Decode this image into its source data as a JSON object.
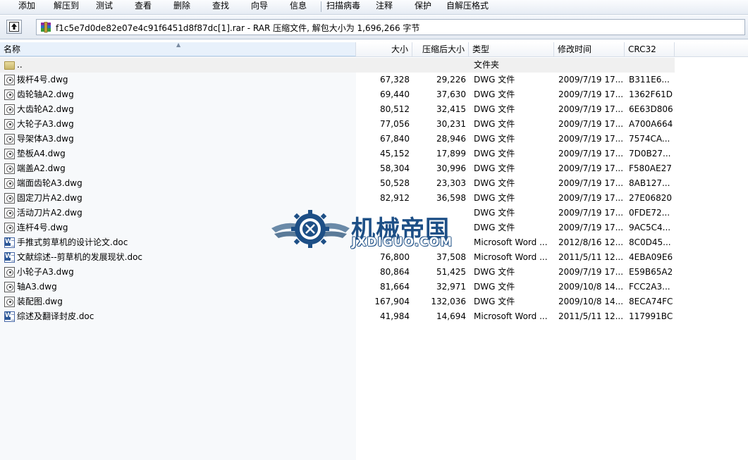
{
  "toolbar": {
    "items": [
      "添加",
      "解压到",
      "测试",
      "查看",
      "删除",
      "查找",
      "向导",
      "信息",
      "扫描病毒",
      "注释",
      "保护",
      "自解压格式"
    ]
  },
  "address": {
    "text": "f1c5e7d0de82e07e4c91f6451d8f87dc[1].rar - RAR 压缩文件, 解包大小为 1,696,266 字节",
    "archive_icon": "winrar-archive-icon",
    "up_icon": "up-folder-icon"
  },
  "columns": {
    "name": "名称",
    "size": "大小",
    "packed": "压缩后大小",
    "type": "类型",
    "modified": "修改时间",
    "crc": "CRC32"
  },
  "parent": {
    "name": "..",
    "type": "文件夹",
    "icon": "folder-icon"
  },
  "files": [
    {
      "name": "拨杆4号.dwg",
      "size": "67,328",
      "packed": "29,226",
      "type": "DWG 文件",
      "modified": "2009/7/19 17...",
      "crc": "B311E6...",
      "icon": "dwg-file-icon"
    },
    {
      "name": "齿轮轴A2.dwg",
      "size": "69,440",
      "packed": "37,630",
      "type": "DWG 文件",
      "modified": "2009/7/19 17...",
      "crc": "1362F61D",
      "icon": "dwg-file-icon"
    },
    {
      "name": "大齿轮A2.dwg",
      "size": "80,512",
      "packed": "32,415",
      "type": "DWG 文件",
      "modified": "2009/7/19 17...",
      "crc": "6E63D806",
      "icon": "dwg-file-icon"
    },
    {
      "name": "大轮子A3.dwg",
      "size": "77,056",
      "packed": "30,231",
      "type": "DWG 文件",
      "modified": "2009/7/19 17...",
      "crc": "A700A664",
      "icon": "dwg-file-icon"
    },
    {
      "name": "导架体A3.dwg",
      "size": "67,840",
      "packed": "28,946",
      "type": "DWG 文件",
      "modified": "2009/7/19 17...",
      "crc": "7574CA...",
      "icon": "dwg-file-icon"
    },
    {
      "name": "垫板A4.dwg",
      "size": "45,152",
      "packed": "17,899",
      "type": "DWG 文件",
      "modified": "2009/7/19 17...",
      "crc": "7D0B27...",
      "icon": "dwg-file-icon"
    },
    {
      "name": "端盖A2.dwg",
      "size": "58,304",
      "packed": "30,996",
      "type": "DWG 文件",
      "modified": "2009/7/19 17...",
      "crc": "F580AE27",
      "icon": "dwg-file-icon"
    },
    {
      "name": "端面齿轮A3.dwg",
      "size": "50,528",
      "packed": "23,303",
      "type": "DWG 文件",
      "modified": "2009/7/19 17...",
      "crc": "8AB127...",
      "icon": "dwg-file-icon"
    },
    {
      "name": "固定刀片A2.dwg",
      "size": "82,912",
      "packed": "36,598",
      "type": "DWG 文件",
      "modified": "2009/7/19 17...",
      "crc": "27E06820",
      "icon": "dwg-file-icon"
    },
    {
      "name": "活动刀片A2.dwg",
      "size": "",
      "packed": "",
      "type": "DWG 文件",
      "modified": "2009/7/19 17...",
      "crc": "0FDE72...",
      "icon": "dwg-file-icon"
    },
    {
      "name": "连杆4号.dwg",
      "size": "",
      "packed": "",
      "type": "DWG 文件",
      "modified": "2009/7/19 17...",
      "crc": "9AC5C4...",
      "icon": "dwg-file-icon"
    },
    {
      "name": "手推式剪草机的设计论文.doc",
      "size": "",
      "packed": "",
      "type": "Microsoft Word ...",
      "modified": "2012/8/16 12...",
      "crc": "8C0D45...",
      "icon": "word-doc-icon"
    },
    {
      "name": "文献综述--剪草机的发展现状.doc",
      "size": "76,800",
      "packed": "37,508",
      "type": "Microsoft Word ...",
      "modified": "2011/5/11 12...",
      "crc": "4EBA09E6",
      "icon": "word-doc-icon"
    },
    {
      "name": "小轮子A3.dwg",
      "size": "80,864",
      "packed": "51,425",
      "type": "DWG 文件",
      "modified": "2009/7/19 17...",
      "crc": "E59B65A2",
      "icon": "dwg-file-icon"
    },
    {
      "name": "轴A3.dwg",
      "size": "81,664",
      "packed": "32,971",
      "type": "DWG 文件",
      "modified": "2009/10/8 14...",
      "crc": "FCC2A3...",
      "icon": "dwg-file-icon"
    },
    {
      "name": "装配图.dwg",
      "size": "167,904",
      "packed": "132,036",
      "type": "DWG 文件",
      "modified": "2009/10/8 14...",
      "crc": "8ECA74FC",
      "icon": "dwg-file-icon"
    },
    {
      "name": "综述及翻译封皮.doc",
      "size": "41,984",
      "packed": "14,694",
      "type": "Microsoft Word ...",
      "modified": "2011/5/11 12...",
      "crc": "117991BC",
      "icon": "word-doc-icon"
    }
  ],
  "watermark": {
    "title": "机械帝国",
    "subtitle": "JXDIGUO.COM",
    "colors": {
      "primary": "#1d4f86",
      "accent": "#6a8aa8"
    }
  }
}
